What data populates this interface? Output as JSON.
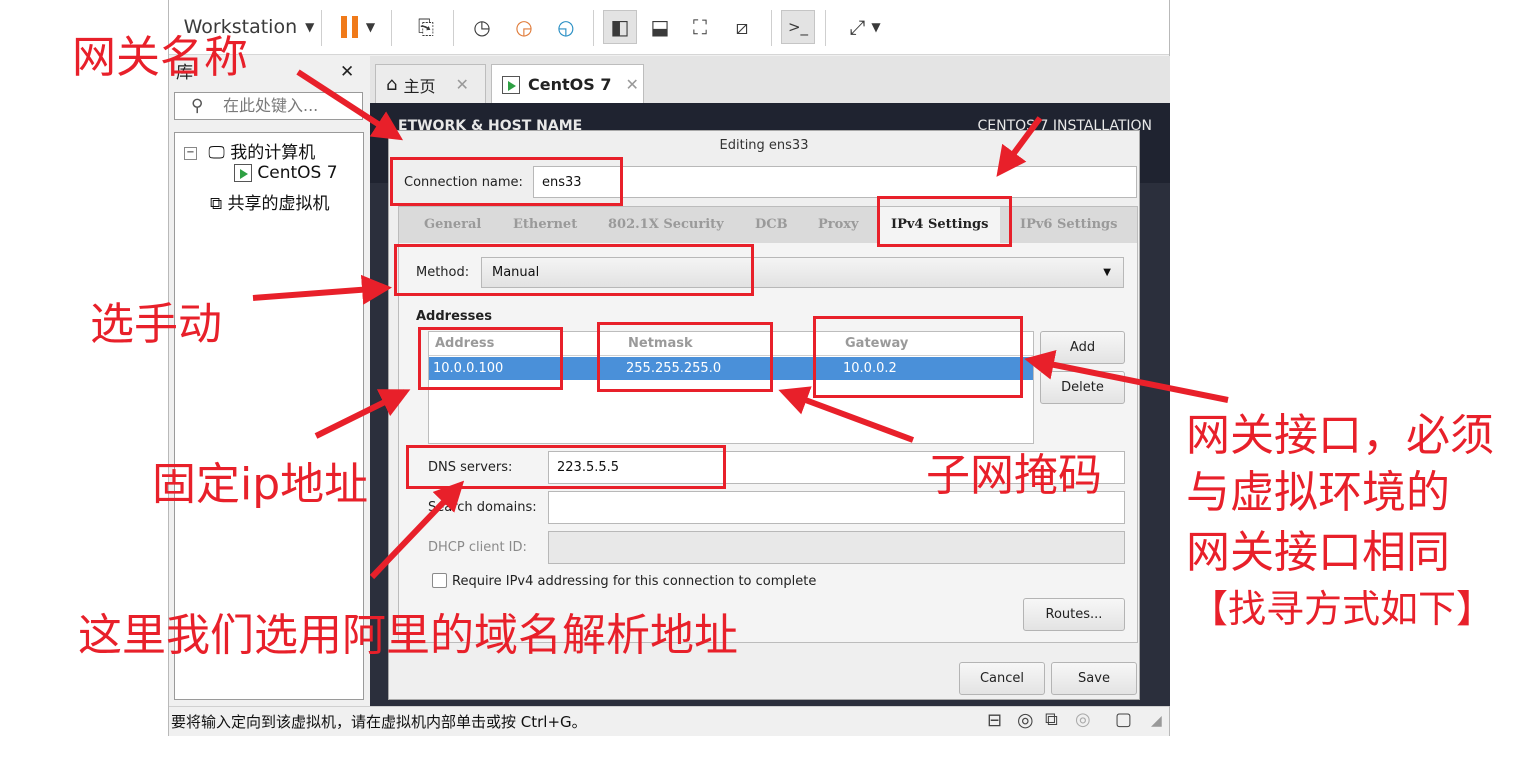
{
  "toolbar": {
    "workstation_label": "Workstation"
  },
  "library": {
    "title": "库",
    "search_placeholder": "在此处键入...",
    "tree": {
      "my_computer": "我的计算机",
      "vm_item": "CentOS 7",
      "shared": "共享的虚拟机"
    }
  },
  "tabs": [
    {
      "label": "主页"
    },
    {
      "label": "CentOS 7"
    }
  ],
  "centos_header": {
    "left": "ETWORK & HOST NAME",
    "right": "CENTOS 7 INSTALLATION"
  },
  "dialog": {
    "title": "Editing ens33",
    "connection_name_label": "Connection name:",
    "connection_name_value": "ens33",
    "notebook_tabs": [
      "General",
      "Ethernet",
      "802.1X Security",
      "DCB",
      "Proxy",
      "IPv4 Settings",
      "IPv6 Settings"
    ],
    "active_tab": "IPv4 Settings",
    "method_label": "Method:",
    "method_value": "Manual",
    "addresses_label": "Addresses",
    "columns": [
      "Address",
      "Netmask",
      "Gateway"
    ],
    "rows": [
      {
        "address": "10.0.0.100",
        "netmask": "255.255.255.0",
        "gateway": "10.0.0.2"
      }
    ],
    "add_label": "Add",
    "delete_label": "Delete",
    "dns_label": "DNS servers:",
    "dns_value": "223.5.5.5",
    "search_domains_label": "Search domains:",
    "dhcp_label": "DHCP client ID:",
    "require_label": "Require IPv4 addressing for this connection to complete",
    "routes_label": "Routes...",
    "cancel_label": "Cancel",
    "save_label": "Save"
  },
  "status_bar": {
    "text": "要将输入定向到该虚拟机，请在虚拟机内部单击或按 Ctrl+G。"
  },
  "annotations": {
    "gateway_name": "网关名称",
    "select_manual": "选手动",
    "fixed_ip": "固定ip地址",
    "subnet_mask": "子网掩码",
    "gateway_note_line1": "网关接口，必须",
    "gateway_note_line2": "与虚拟环境的",
    "gateway_note_line3": "网关接口相同",
    "gateway_note_line4": "【找寻方式如下】",
    "dns_note": "这里我们选用阿里的域名解析地址"
  },
  "colors": {
    "annotation_red": "#e8202a",
    "selection_blue": "#4a90d9",
    "pause_orange": "#f07a1a"
  }
}
